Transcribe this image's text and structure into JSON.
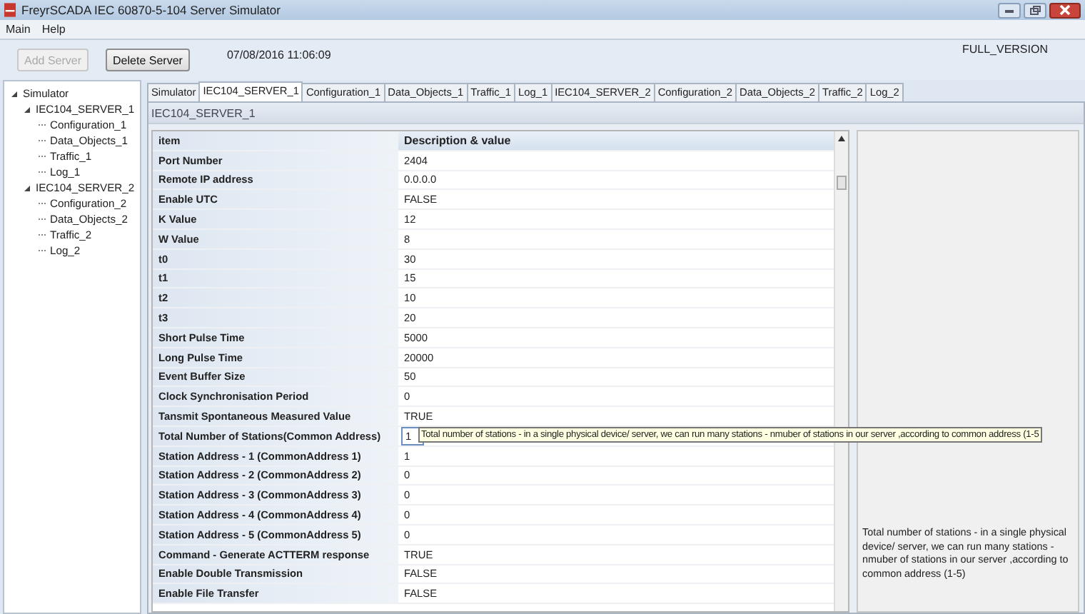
{
  "window": {
    "title": "FreyrSCADA IEC 60870-5-104 Server Simulator"
  },
  "menu": [
    "Main",
    "Help"
  ],
  "toolbar": {
    "buttons": [
      {
        "label": "Add Server",
        "disabled": true
      },
      {
        "label": "Delete Server",
        "disabled": false
      }
    ],
    "timestamp": "07/08/2016 11:06:09",
    "edition": "FULL_VERSION"
  },
  "tree": [
    {
      "label": "Simulator",
      "expanded": true,
      "children": [
        {
          "label": "IEC104_SERVER_1",
          "expanded": true,
          "children": [
            {
              "label": "Configuration_1"
            },
            {
              "label": "Data_Objects_1"
            },
            {
              "label": "Traffic_1"
            },
            {
              "label": "Log_1"
            }
          ]
        },
        {
          "label": "IEC104_SERVER_2",
          "expanded": true,
          "children": [
            {
              "label": "Configuration_2"
            },
            {
              "label": "Data_Objects_2"
            },
            {
              "label": "Traffic_2"
            },
            {
              "label": "Log_2"
            }
          ]
        }
      ]
    }
  ],
  "tabs": [
    {
      "label": "Simulator",
      "selected": false
    },
    {
      "label": "IEC104_SERVER_1",
      "selected": true
    },
    {
      "label": "Configuration_1",
      "selected": false
    },
    {
      "label": "Data_Objects_1",
      "selected": false
    },
    {
      "label": "Traffic_1",
      "selected": false
    },
    {
      "label": "Log_1",
      "selected": false
    },
    {
      "label": "IEC104_SERVER_2",
      "selected": false
    },
    {
      "label": "Configuration_2",
      "selected": false
    },
    {
      "label": "Data_Objects_2",
      "selected": false
    },
    {
      "label": "Traffic_2",
      "selected": false
    },
    {
      "label": "Log_2",
      "selected": false
    }
  ],
  "panel_title": "IEC104_SERVER_1",
  "table": {
    "columns": [
      "item",
      "Description & value"
    ],
    "rows": [
      {
        "item": "Port Number",
        "value": "2404",
        "editing": false
      },
      {
        "item": "Remote IP address",
        "value": "0.0.0.0",
        "editing": false
      },
      {
        "item": "Enable UTC",
        "value": "FALSE",
        "editing": false
      },
      {
        "item": "K Value",
        "value": "12",
        "editing": false
      },
      {
        "item": "W Value",
        "value": "8",
        "editing": false
      },
      {
        "item": "t0",
        "value": "30",
        "editing": false
      },
      {
        "item": "t1",
        "value": "15",
        "editing": false
      },
      {
        "item": "t2",
        "value": "10",
        "editing": false
      },
      {
        "item": "t3",
        "value": "20",
        "editing": false
      },
      {
        "item": "Short Pulse Time",
        "value": "5000",
        "editing": false
      },
      {
        "item": "Long Pulse Time",
        "value": "20000",
        "editing": false
      },
      {
        "item": "Event Buffer Size",
        "value": "50",
        "editing": false
      },
      {
        "item": "Clock Synchronisation Period",
        "value": "0",
        "editing": false
      },
      {
        "item": "Tansmit Spontaneous Measured Value",
        "value": "TRUE",
        "editing": false
      },
      {
        "item": "Total Number of Stations(Common Address)",
        "value": "1",
        "editing": true
      },
      {
        "item": "Station Address - 1 (CommonAddress 1)",
        "value": "1",
        "editing": false
      },
      {
        "item": "Station Address - 2 (CommonAddress 2)",
        "value": "0",
        "editing": false
      },
      {
        "item": "Station Address - 3 (CommonAddress 3)",
        "value": "0",
        "editing": false
      },
      {
        "item": "Station Address - 4 (CommonAddress 4)",
        "value": "0",
        "editing": false
      },
      {
        "item": "Station Address - 5 (CommonAddress 5)",
        "value": "0",
        "editing": false
      },
      {
        "item": "Command - Generate ACTTERM response",
        "value": "TRUE",
        "editing": false
      },
      {
        "item": "Enable Double Transmission",
        "value": "FALSE",
        "editing": false
      },
      {
        "item": "Enable File Transfer",
        "value": "FALSE",
        "editing": false
      }
    ]
  },
  "tooltip": "Total number of stations - in a single physical device/ server, we can run many stations - nmuber of stations in our server ,according to common address (1-5",
  "description": "Total number of stations - in a single physical device/ server, we can run many stations - nmuber of stations in our server ,according to common address (1-5)"
}
